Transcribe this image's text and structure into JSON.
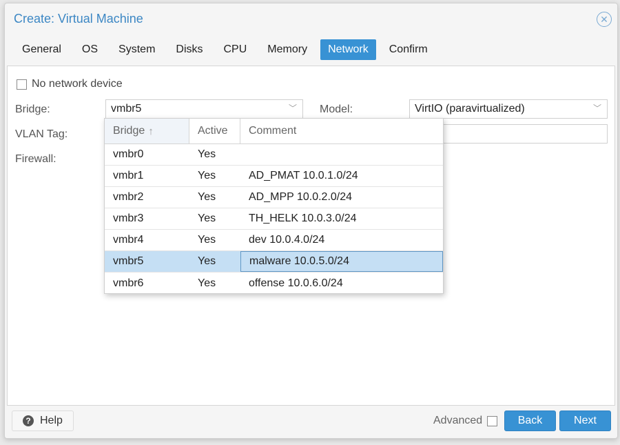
{
  "window": {
    "title": "Create: Virtual Machine",
    "close_icon": "⨂"
  },
  "tabs": [
    {
      "label": "General",
      "active": false
    },
    {
      "label": "OS",
      "active": false
    },
    {
      "label": "System",
      "active": false
    },
    {
      "label": "Disks",
      "active": false
    },
    {
      "label": "CPU",
      "active": false
    },
    {
      "label": "Memory",
      "active": false
    },
    {
      "label": "Network",
      "active": true
    },
    {
      "label": "Confirm",
      "active": false
    }
  ],
  "form": {
    "no_network_device": {
      "label": "No network device",
      "checked": false
    },
    "bridge": {
      "label": "Bridge:",
      "value": "vmbr5"
    },
    "vlan_tag": {
      "label": "VLAN Tag:",
      "value": ""
    },
    "firewall": {
      "label": "Firewall:"
    },
    "model": {
      "label": "Model:",
      "value": "VirtIO (paravirtualized)"
    },
    "mac_address": {
      "value": ""
    }
  },
  "dropdown": {
    "columns": [
      {
        "label": "Bridge",
        "sort": "ascending",
        "sort_icon": "↑"
      },
      {
        "label": "Active"
      },
      {
        "label": "Comment"
      }
    ],
    "rows": [
      {
        "bridge": "vmbr0",
        "active": "Yes",
        "comment": "",
        "selected": false
      },
      {
        "bridge": "vmbr1",
        "active": "Yes",
        "comment": "AD_PMAT 10.0.1.0/24",
        "selected": false
      },
      {
        "bridge": "vmbr2",
        "active": "Yes",
        "comment": "AD_MPP 10.0.2.0/24",
        "selected": false
      },
      {
        "bridge": "vmbr3",
        "active": "Yes",
        "comment": "TH_HELK 10.0.3.0/24",
        "selected": false
      },
      {
        "bridge": "vmbr4",
        "active": "Yes",
        "comment": "dev 10.0.4.0/24",
        "selected": false
      },
      {
        "bridge": "vmbr5",
        "active": "Yes",
        "comment": "malware 10.0.5.0/24",
        "selected": true
      },
      {
        "bridge": "vmbr6",
        "active": "Yes",
        "comment": "offense 10.0.6.0/24",
        "selected": false
      }
    ]
  },
  "footer": {
    "help_label": "Help",
    "help_icon": "?",
    "advanced_label": "Advanced",
    "advanced_checked": false,
    "back_label": "Back",
    "next_label": "Next"
  },
  "colors": {
    "accent": "#3892d4",
    "title": "#3c87c4",
    "selected_row": "#c5dff4"
  }
}
